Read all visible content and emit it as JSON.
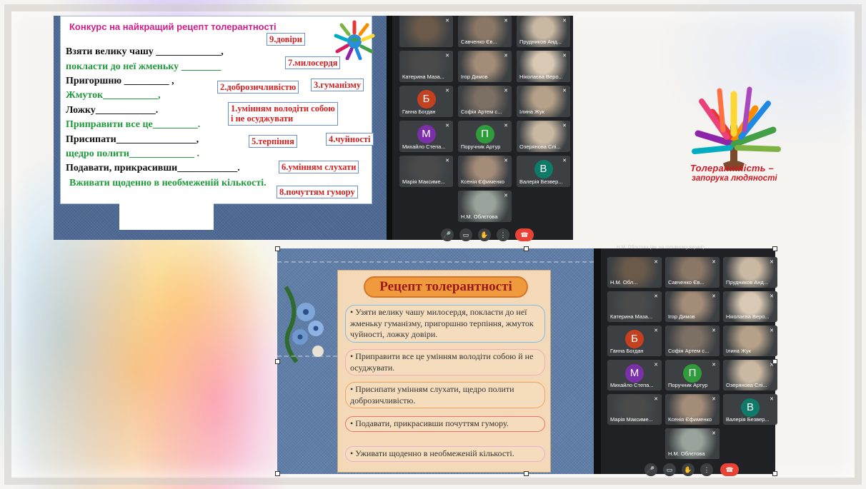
{
  "worksheet": {
    "title": "Конкурс на найкращий рецепт толерантності",
    "lines": [
      "Взяти велику чашу _____________,",
      "покласти до неї жменьку ________",
      "Пригоршню _________ ,",
      "Жмуток___________,",
      "Ложку____________.",
      "Приправити все це_________.",
      "Присипати________________,",
      "щедро полити_____________ .",
      "Подавати, прикрасивши____________.",
      "Вживати щоденно в необмеженій кількості."
    ],
    "options": [
      "9.довіри",
      "7.милосердя",
      "2.доброзичливістю",
      "3.гуманізму",
      "1.умінням володіти собою\nі не осуджувати",
      "5.терпіння",
      "4.чуйності",
      "6.умінням слухати",
      "8.почуттям гумору"
    ]
  },
  "meet_top": {
    "tiles": [
      {
        "name": "",
        "avatar": "",
        "color": ""
      },
      {
        "name": "Савченко Єв...",
        "avatar": "",
        "color": ""
      },
      {
        "name": "Прудников Анд...",
        "avatar": "",
        "color": ""
      },
      {
        "name": "Катерина Маза...",
        "avatar": "",
        "color": ""
      },
      {
        "name": "Ігор Димов",
        "avatar": "",
        "color": ""
      },
      {
        "name": "Ніколаєва Веро...",
        "avatar": "",
        "color": ""
      },
      {
        "name": "Ганна Богдан",
        "avatar": "Б",
        "color": "#c5401f"
      },
      {
        "name": "Софія Артем с...",
        "avatar": "",
        "color": ""
      },
      {
        "name": "Ілина Жук",
        "avatar": "",
        "color": ""
      },
      {
        "name": "Михайло Степа...",
        "avatar": "М",
        "color": "#7b2fa8"
      },
      {
        "name": "Поручник Артур",
        "avatar": "П",
        "color": "#2f9b3a"
      },
      {
        "name": "Озерянова Слі...",
        "avatar": "",
        "color": ""
      },
      {
        "name": "Марія Максиме...",
        "avatar": "",
        "color": ""
      },
      {
        "name": "Ксенія Єфименко",
        "avatar": "",
        "color": ""
      },
      {
        "name": "Валерія Безвер...",
        "avatar": "В",
        "color": "#0e7a6a"
      },
      {
        "name": "Н.М. Облєтова",
        "avatar": "",
        "color": ""
      }
    ]
  },
  "meet_bottom": {
    "header": "Н.М. Облєтова (ви, на головному екрані)",
    "tiles": [
      {
        "name": "Н.М. Обл...",
        "avatar": "",
        "color": ""
      },
      {
        "name": "Савченко Єв...",
        "avatar": "",
        "color": ""
      },
      {
        "name": "Прудников Анд...",
        "avatar": "",
        "color": ""
      },
      {
        "name": "Катерина Маза...",
        "avatar": "",
        "color": ""
      },
      {
        "name": "Ігор Димов",
        "avatar": "",
        "color": ""
      },
      {
        "name": "Ніколаєва Веро...",
        "avatar": "",
        "color": ""
      },
      {
        "name": "Ганна Богдан",
        "avatar": "Б",
        "color": "#c5401f"
      },
      {
        "name": "Софія Артем с...",
        "avatar": "",
        "color": ""
      },
      {
        "name": "Ілина Жук",
        "avatar": "",
        "color": ""
      },
      {
        "name": "Михайло Степа...",
        "avatar": "М",
        "color": "#7b2fa8"
      },
      {
        "name": "Поручник Артур",
        "avatar": "П",
        "color": "#2f9b3a"
      },
      {
        "name": "Озерянова Слі...",
        "avatar": "",
        "color": ""
      },
      {
        "name": "Марія Максиме...",
        "avatar": "",
        "color": ""
      },
      {
        "name": "Ксенія Єфименко",
        "avatar": "",
        "color": ""
      },
      {
        "name": "Валерія Безвер...",
        "avatar": "В",
        "color": "#0e7a6a"
      },
      {
        "name": "Н.М. Облєтова",
        "avatar": "",
        "color": ""
      }
    ]
  },
  "logo": {
    "line1": "Толерантність –",
    "line2": "запорука людяності"
  },
  "poster": {
    "title": "Рецепт толерантності",
    "items": [
      "• Узяти велику чашу милосердя, покласти до неї жменьку гуманізму, пригоршню терпіння, жмуток чуйності, ложку довіри.",
      "• Приправити все це умінням володіти собою й не осуджувати.",
      "• Присипати умінням слухати, щедро полити доброзичливістю.",
      "• Подавати, прикрасивши почуттям гумору.",
      "• Уживати щоденно в необмеженій кількості."
    ]
  },
  "colors": {
    "accent_red": "#d21a24",
    "meet_bg": "#202124",
    "tile_bg": "#3c4043",
    "end_call": "#ea4335"
  }
}
